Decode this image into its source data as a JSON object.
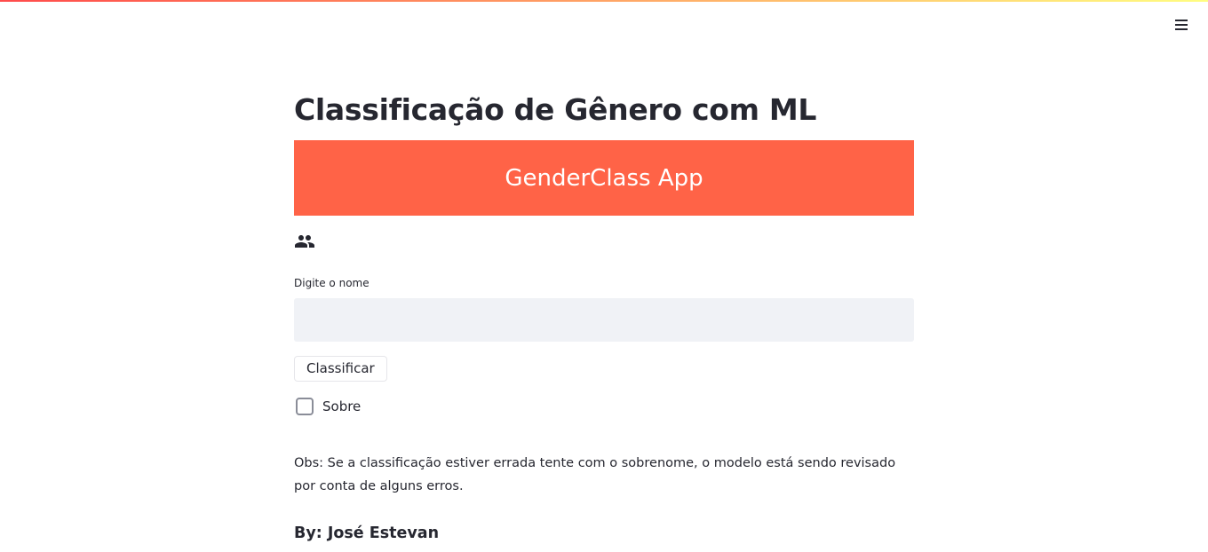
{
  "header": {
    "menu_icon": "hamburger-icon",
    "decoration_colors": [
      "#ff4b4b",
      "#fffd80"
    ]
  },
  "main": {
    "title": "Classificação de Gênero com ML",
    "banner": {
      "text": "GenderClass App",
      "background": "#ff6347",
      "text_color": "#ffffff"
    },
    "section_icon": "people-icon",
    "name_input": {
      "label": "Digite o nome",
      "value": "",
      "placeholder": ""
    },
    "classify_button": {
      "label": "Classificar"
    },
    "about_checkbox": {
      "label": "Sobre",
      "checked": false
    },
    "note": "Obs: Se a classificação estiver errada tente com o sobrenome, o modelo está sendo revisado por conta de alguns erros.",
    "author": "By: José Estevan"
  }
}
